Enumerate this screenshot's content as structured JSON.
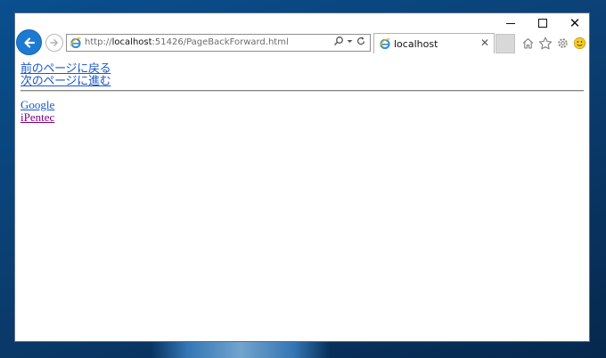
{
  "window": {
    "controls": [
      "minimize",
      "maximize",
      "close"
    ]
  },
  "toolbar": {
    "url_prefix": "http://",
    "url_host": "localhost",
    "url_rest": ":51426/PageBackForward.html"
  },
  "tab": {
    "label": "localhost"
  },
  "content": {
    "link_back": "前のページに戻る",
    "link_forward": "次のページに進む",
    "links": [
      {
        "label": "Google",
        "color": "#1a58c8"
      },
      {
        "label": "iPentec",
        "color": "#800080"
      }
    ]
  },
  "colors": {
    "back_button": "#1d7ad2",
    "link": "#1a58c8",
    "visited": "#800080"
  }
}
